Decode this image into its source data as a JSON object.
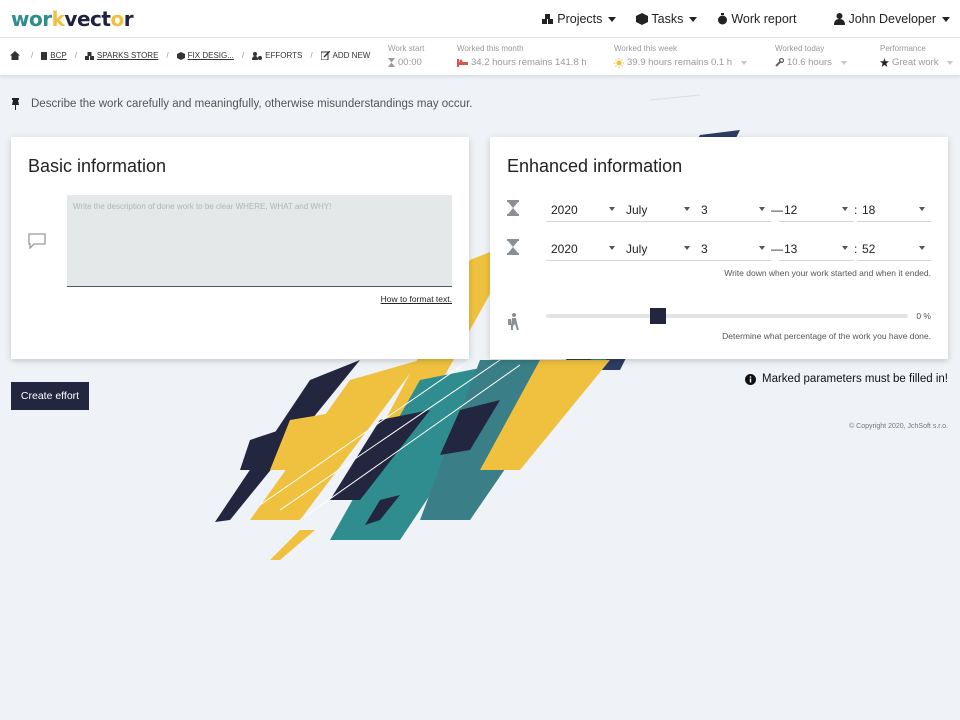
{
  "brand": {
    "logo_a": "wor",
    "logo_b": "k",
    "logo_c": "vect",
    "logo_d": "o",
    "logo_e": "r"
  },
  "topnav": {
    "projects": "Projects",
    "tasks": "Tasks",
    "work_report": "Work report",
    "user": "John Developer"
  },
  "breadcrumb": {
    "item1": "BCP",
    "item2": "SPARKS STORE",
    "item3": "FIX DESIG...",
    "item4": "EFFORTS",
    "item5": "ADD NEW"
  },
  "stats": {
    "work_start": {
      "label": "Work start",
      "value": "00:00"
    },
    "month": {
      "label": "Worked this month",
      "value": "34.2 hours remains 141.8 h"
    },
    "week": {
      "label": "Worked this week",
      "value": "39.9 hours remains 0.1 h"
    },
    "today": {
      "label": "Worked today",
      "value": "10.6 hours"
    },
    "performance": {
      "label": "Performance",
      "value": "Great work"
    }
  },
  "notice": "Describe the work carefully and meaningfully, otherwise misunderstandings may occur.",
  "basic": {
    "title": "Basic information",
    "placeholder": "Write the description of done work to be clear WHERE, WHAT and WHY!",
    "format_link": "How to format text."
  },
  "enhanced": {
    "title": "Enhanced information",
    "start": {
      "year": "2020",
      "month": "July",
      "day": "3",
      "hour": "12",
      "minute": "18"
    },
    "end": {
      "year": "2020",
      "month": "July",
      "day": "3",
      "hour": "13",
      "minute": "52"
    },
    "dash": "—",
    "colon": ":",
    "time_hint": "Write down when your work started and when it ended.",
    "progress_value": "0 %",
    "progress_hint": "Determine what percentage of the work you have done."
  },
  "actions": {
    "create": "Create effort"
  },
  "required_note": "Marked parameters must be filled in!",
  "copyright": "© Copyright 2020, JchSoft s.r.o.",
  "colors": {
    "navy": "#23263f",
    "teal": "#2f8c8f",
    "yellow": "#efc13e"
  }
}
